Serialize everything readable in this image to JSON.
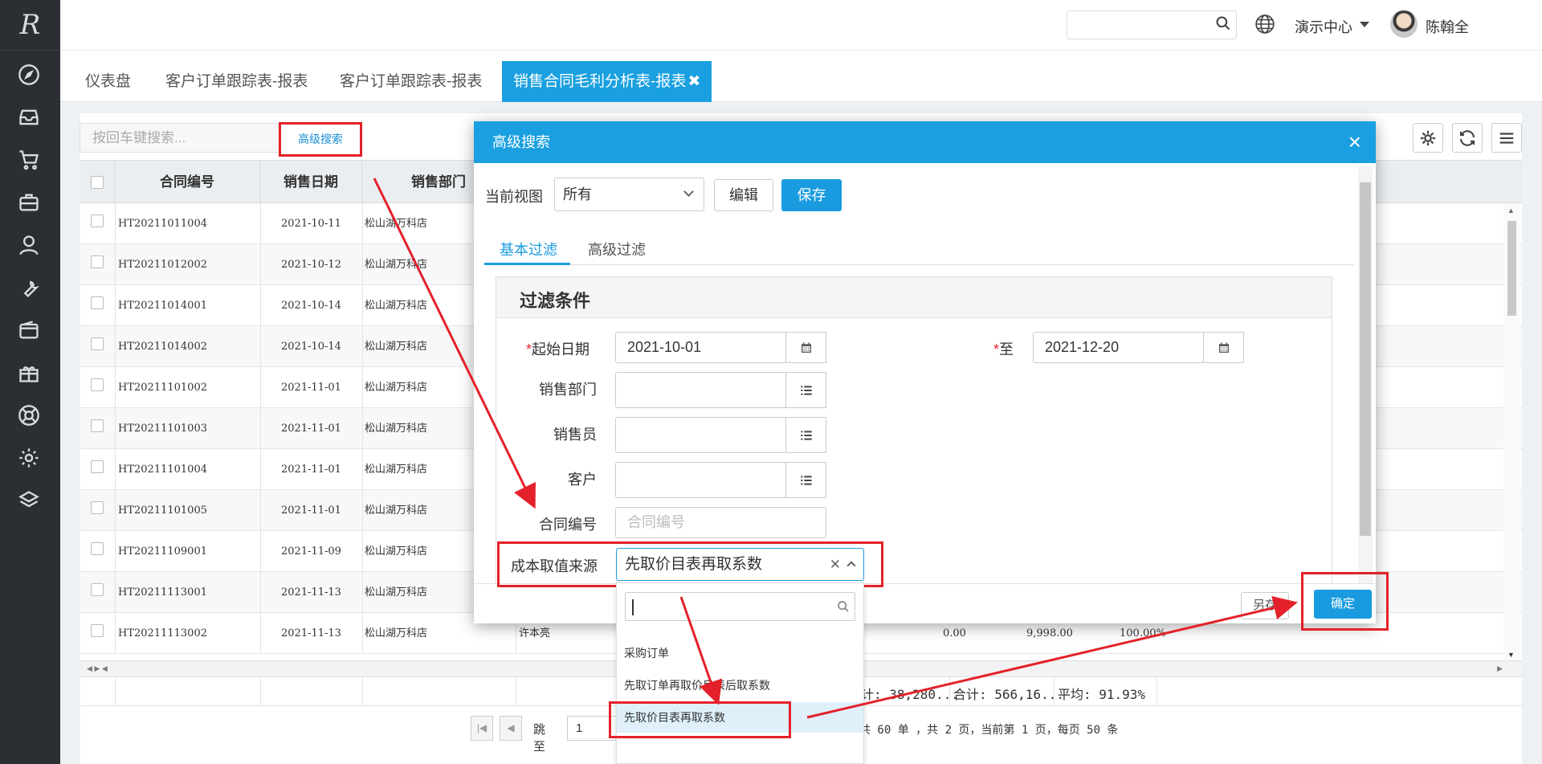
{
  "app": {
    "logo_text": "R"
  },
  "sidebar": {
    "icons": [
      "compass-icon",
      "inbox-icon",
      "cart-icon",
      "briefcase-icon",
      "user-icon",
      "wrench-icon",
      "wallet-icon",
      "gift-icon",
      "lifebuoy-icon",
      "gear-icon",
      "layers-icon"
    ]
  },
  "header": {
    "search_placeholder": "",
    "center_label": "演示中心",
    "username": "陈翰全",
    "help_label": "?"
  },
  "tabs": [
    {
      "label": "仪表盘",
      "active": false
    },
    {
      "label": "客户订单跟踪表-报表",
      "active": false
    },
    {
      "label": "客户订单跟踪表-报表",
      "active": false
    },
    {
      "label": "销售合同毛利分析表-报表",
      "active": true,
      "close": "✖"
    }
  ],
  "toolbar": {
    "search_placeholder": "按回车键搜索...",
    "advanced_search_label": "高级搜索"
  },
  "table": {
    "columns": [
      "合同编号",
      "销售日期",
      "销售部门"
    ],
    "rows": [
      [
        "HT20211011004",
        "2021-10-11",
        "松山湖万科店"
      ],
      [
        "HT20211012002",
        "2021-10-12",
        "松山湖万科店"
      ],
      [
        "HT20211014001",
        "2021-10-14",
        "松山湖万科店"
      ],
      [
        "HT20211014002",
        "2021-10-14",
        "松山湖万科店"
      ],
      [
        "HT20211101002",
        "2021-11-01",
        "松山湖万科店"
      ],
      [
        "HT20211101003",
        "2021-11-01",
        "松山湖万科店"
      ],
      [
        "HT20211101004",
        "2021-11-01",
        "松山湖万科店"
      ],
      [
        "HT20211101005",
        "2021-11-01",
        "松山湖万科店"
      ],
      [
        "HT20211109001",
        "2021-11-09",
        "松山湖万科店"
      ],
      [
        "HT20211113001",
        "2021-11-13",
        "松山湖万科店"
      ],
      [
        "HT20211113002",
        "2021-11-13",
        "松山湖万科店"
      ]
    ],
    "last_row_extra": {
      "salesperson": "许本亮",
      "v1": "0.00",
      "v2": "9,998.00",
      "v3": "100.00%"
    },
    "footer": {
      "sum1": "计: 38,280...",
      "sum2": "合计: 566,16...",
      "avg": "平均: 91.93%"
    }
  },
  "pager": {
    "jump_label": "跳至",
    "page_value": "1",
    "info": "共 60 单 ，共 2 页，当前第 1 页，每页 50 条",
    "first_icon": "first-page-icon",
    "prev_icon": "prev-page-icon"
  },
  "modal": {
    "title": "高级搜索",
    "close": "×",
    "view_label": "当前视图",
    "view_value": "所有",
    "edit_label": "编辑",
    "save_label": "保存",
    "tabs": [
      "基本过滤",
      "高级过滤"
    ],
    "filter_title": "过滤条件",
    "fields": {
      "start_date_label": "起始日期",
      "start_date_value": "2021-10-01",
      "to_label": "至",
      "end_date_value": "2021-12-20",
      "dept_label": "销售部门",
      "salesperson_label": "销售员",
      "customer_label": "客户",
      "contract_label": "合同编号",
      "contract_placeholder": "合同编号",
      "cost_label": "成本取值来源",
      "cost_value": "先取价目表再取系数",
      "required_mark": "*"
    },
    "other_label": "另存",
    "confirm_label": "确定"
  },
  "dropdown": {
    "options": [
      "采购订单",
      "先取订单再取价目表后取系数",
      "先取价目表再取系数"
    ],
    "selected_index": 2
  },
  "colors": {
    "accent": "#1aa0e0",
    "highlight": "#e4212a",
    "sidebar": "#2b2f33"
  }
}
